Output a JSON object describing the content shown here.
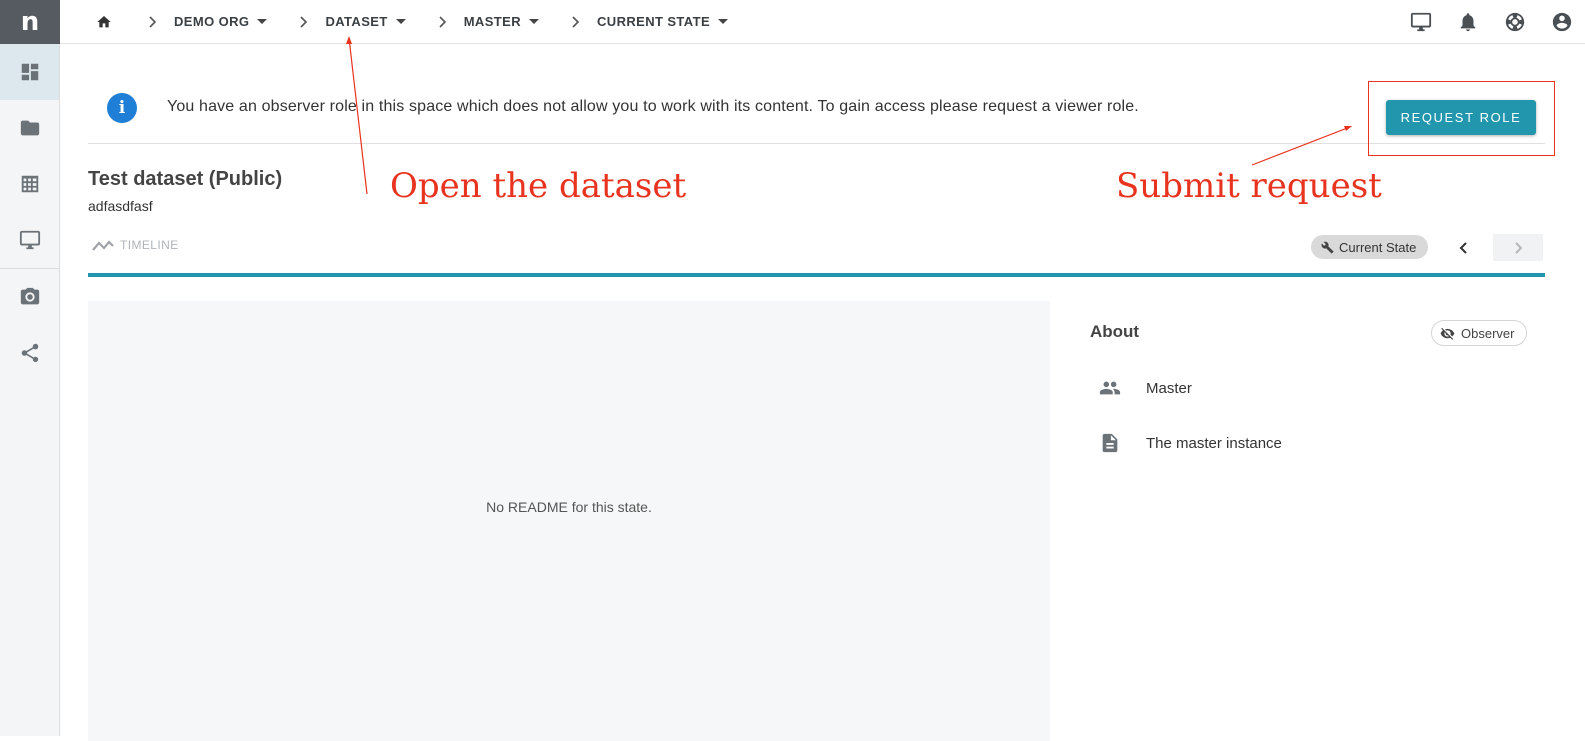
{
  "app": {
    "logo_letter": "n"
  },
  "sidebar": {
    "items": [
      {
        "icon": "dashboard-icon",
        "active": true
      },
      {
        "icon": "folder-icon",
        "active": false
      },
      {
        "icon": "table-icon",
        "active": false
      },
      {
        "icon": "monitor-icon",
        "active": false
      },
      {
        "icon": "camera-icon",
        "active": false
      },
      {
        "icon": "share-icon",
        "active": false
      }
    ]
  },
  "breadcrumb": {
    "home_icon": "home-icon",
    "items": [
      {
        "label": "DEMO ORG"
      },
      {
        "label": "DATASET"
      },
      {
        "label": "MASTER"
      },
      {
        "label": "CURRENT STATE"
      }
    ]
  },
  "topbar_icons": [
    "monitor-icon",
    "bell-icon",
    "lifebuoy-icon",
    "account-icon"
  ],
  "notice": {
    "text": "You have an observer role in this space which does not allow you to work with its content. To gain access please request a viewer role.",
    "button_label": "REQUEST ROLE"
  },
  "dataset": {
    "title": "Test dataset (Public)",
    "subtitle": "adfasdfasf"
  },
  "tabs": {
    "timeline_label": "TIMELINE",
    "state_label": "Current State"
  },
  "readme": {
    "empty_text": "No README for this state."
  },
  "about": {
    "title": "About",
    "role_chip": "Observer",
    "rows": [
      {
        "icon": "people-icon",
        "text": "Master"
      },
      {
        "icon": "document-icon",
        "text": "The master instance"
      }
    ]
  },
  "annotations": {
    "open_dataset": "Open the dataset",
    "submit_request": "Submit request"
  },
  "colors": {
    "accent": "#2196ad",
    "info_blue": "#1f7fd6",
    "annotation_red": "#e8331f",
    "logo_bg": "#555b60"
  }
}
